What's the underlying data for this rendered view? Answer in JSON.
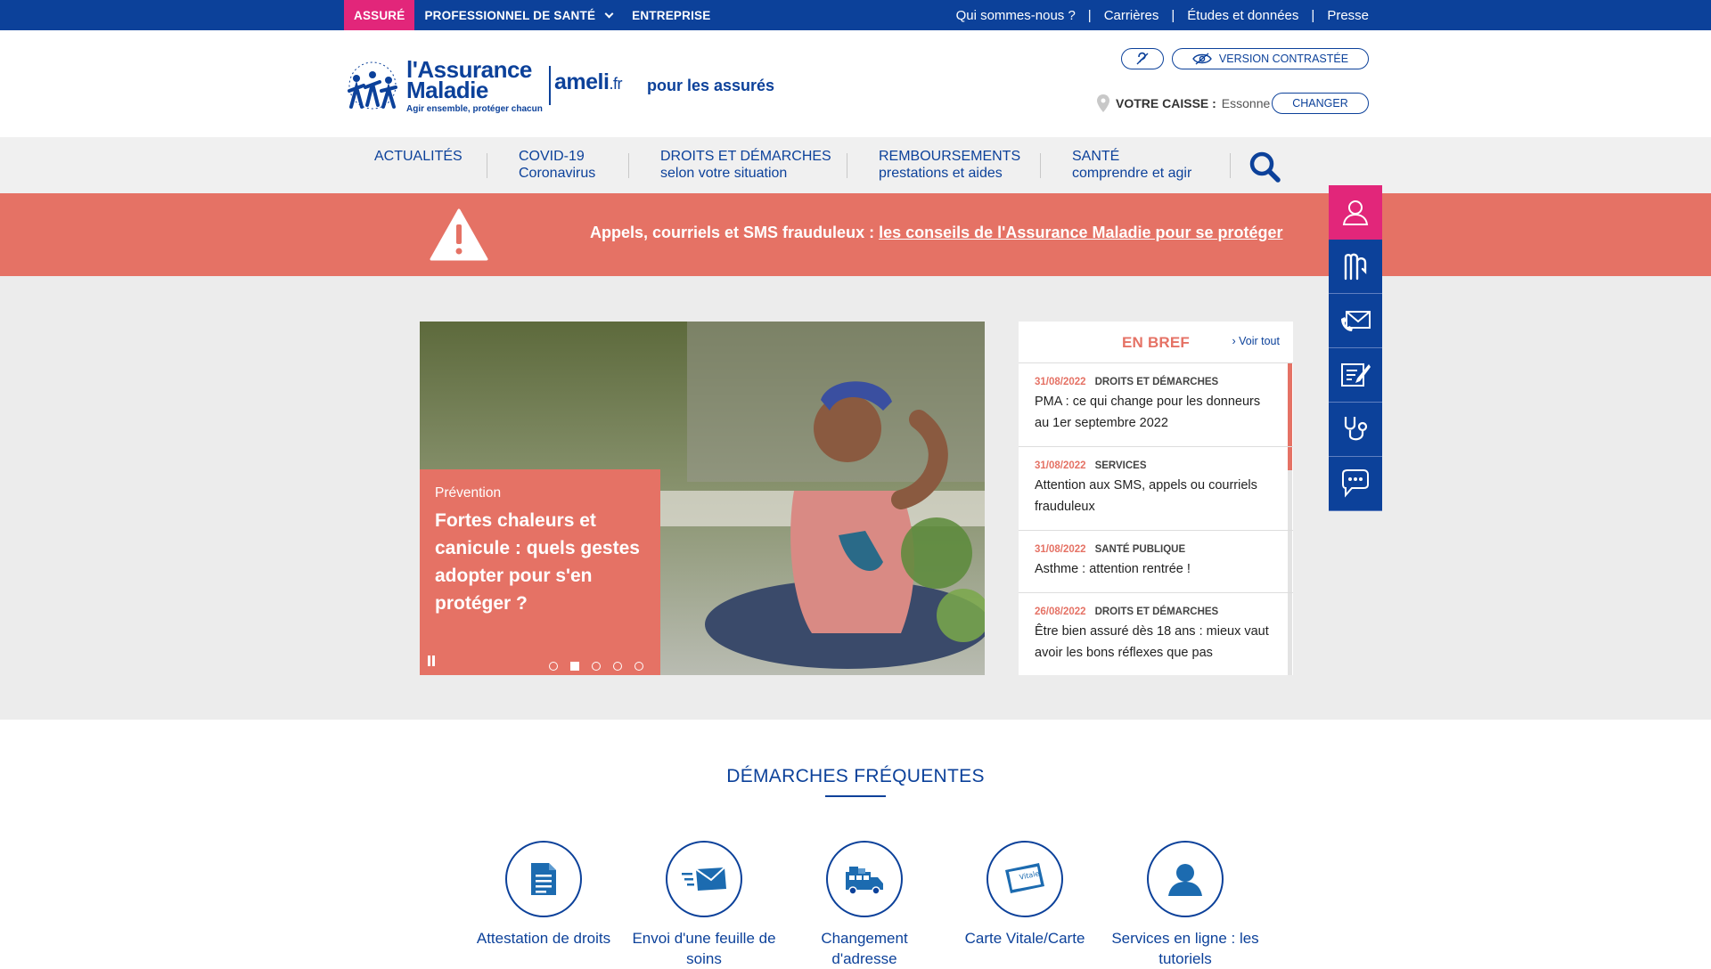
{
  "topbar": {
    "audiences": [
      {
        "label": "ASSURÉ"
      },
      {
        "label": "PROFESSIONNEL DE SANTÉ"
      },
      {
        "label": "ENTREPRISE"
      }
    ],
    "links": [
      "Qui sommes-nous ?",
      "Carrières",
      "Études et données",
      "Presse"
    ],
    "separator": "|"
  },
  "header": {
    "logo_line1": "l'Assurance",
    "logo_line2": "Maladie",
    "logo_tagline": "Agir ensemble, protéger chacun",
    "ameli": "ameli",
    "ameli_tld": ".fr",
    "audience": "pour les assurés",
    "contrast_label": "VERSION CONTRASTÉE",
    "caisse_label": "VOTRE CAISSE :",
    "caisse_value": "Essonne",
    "change_label": "CHANGER"
  },
  "nav": [
    {
      "l1": "ACTUALITÉS",
      "l2": ""
    },
    {
      "l1": "COVID-19",
      "l2": "Coronavirus"
    },
    {
      "l1": "DROITS ET DÉMARCHES",
      "l2": "selon votre situation"
    },
    {
      "l1": "REMBOURSEMENTS",
      "l2": "prestations et aides"
    },
    {
      "l1": "SANTÉ",
      "l2": "comprendre et agir"
    }
  ],
  "alert": {
    "prefix": "Appels, courriels et SMS frauduleux : ",
    "link": "les conseils de l'Assurance Maladie pour se protéger"
  },
  "slider": {
    "category": "Prévention",
    "title": "Fortes chaleurs et canicule : quels gestes adopter pour s'en protéger ?",
    "active_slide": 2,
    "slide_count": 5
  },
  "bref": {
    "title": "EN BREF",
    "see_all": "Voir tout",
    "items": [
      {
        "date": "31/08/2022",
        "category": "DROITS ET DÉMARCHES",
        "text": "PMA : ce qui change pour les donneurs au 1er septembre 2022"
      },
      {
        "date": "31/08/2022",
        "category": "SERVICES",
        "text": "Attention aux SMS, appels ou courriels frauduleux"
      },
      {
        "date": "31/08/2022",
        "category": "SANTÉ PUBLIQUE",
        "text": "Asthme : attention rentrée !"
      },
      {
        "date": "26/08/2022",
        "category": "DROITS ET DÉMARCHES",
        "text": "Être bien assuré dès 18 ans : mieux vaut avoir les bons réflexes que pas"
      }
    ]
  },
  "demarches": {
    "title": "DÉMARCHES FRÉQUENTES",
    "items": [
      {
        "label": "Attestation de droits",
        "icon": "document-icon"
      },
      {
        "label": "Envoi d'une feuille de soins",
        "icon": "envelope-icon"
      },
      {
        "label": "Changement d'adresse",
        "icon": "moving-truck-icon"
      },
      {
        "label": "Carte Vitale/Carte",
        "icon": "vitale-card-icon"
      },
      {
        "label": "Services en ligne : les tutoriels",
        "icon": "user-icon"
      }
    ]
  },
  "colors": {
    "brand_blue": "#0c419a",
    "accent_pink": "#e2267a",
    "alert_coral": "#e57265"
  }
}
